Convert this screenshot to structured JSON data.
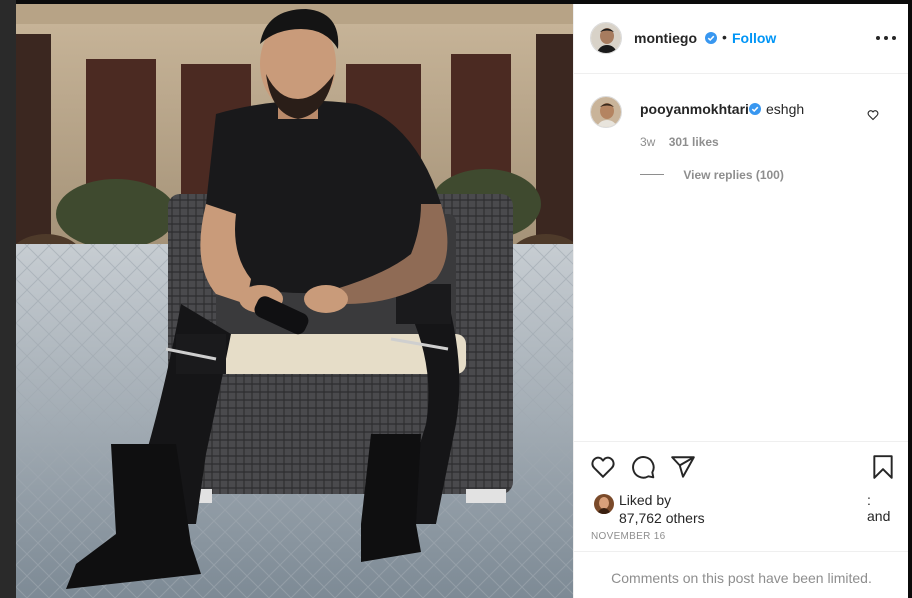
{
  "post": {
    "author": {
      "username": "montiego",
      "verified": true,
      "follow_label": "Follow",
      "separator": "•"
    },
    "menu_icon": "more-options-icon",
    "photo_alt": "Post photo"
  },
  "comment": {
    "username": "pooyanmokhtari",
    "verified": true,
    "text": "eshgh",
    "age": "3w",
    "likes": "301 likes",
    "view_replies": "View replies (100)"
  },
  "actions": {
    "icons": [
      "heart-icon",
      "comment-icon",
      "share-icon",
      "bookmark-icon"
    ]
  },
  "likes": {
    "liked_by": "Liked by",
    "and": ": and",
    "others": "87,762 others"
  },
  "date": "NOVEMBER 16",
  "comments_limited": "Comments on this post have been limited.",
  "colors": {
    "accent": "#0095f6",
    "text": "#262626",
    "muted": "#8e8e8e",
    "border": "#efefef"
  }
}
